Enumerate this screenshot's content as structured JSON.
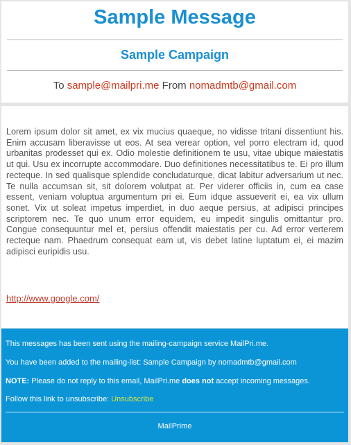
{
  "header": {
    "title": "Sample Message",
    "campaign": "Sample Campaign",
    "to_label": "To",
    "to_email": "sample@mailpri.me",
    "from_label": "From",
    "from_email": "nomadmtb@gmail.com"
  },
  "body": {
    "text": "Lorem ipsum dolor sit amet, ex vix mucius quaeque, no vidisse tritani dissentiunt his. Enim accusam liberavisse ut eos. At sea verear option, vel porro electram id, quod urbanitas prodesset qui ex. Odio molestie definitionem te usu, vitae ubique maiestatis ut qui. Usu ex incorrupte accommodare. Duo definitiones necessitatibus te. Ei pro illum recteque. In sed qualisque splendide concludaturque, dicat labitur adversarium ut nec. Te nulla accumsan sit, sit dolorem volutpat at. Per viderer officiis in, cum ea case essent, veniam voluptua argumentum pri ei. Eum idque assueverit ei, ea vix ullum sonet. Vix ut soleat impetus imperdiet, in duo aeque persius, at adipisci principes scriptorem nec. Te quo unum error equidem, eu impedit singulis omittantur pro. Congue consequuntur mel et, persius offendit maiestatis per cu. Ad error verterem recteque nam. Phaedrum consequat eam ut, vis debet latine luptatum ei, ei mazim adipisci euripidis usu.",
    "link": "http://www.google.com/"
  },
  "footer": {
    "line1": "This messages has been sent using the mailing-campaign service MailPri.me.",
    "line2": "You have been added to the mailing-list: Sample Campaign by nomadmtb@gmail.com",
    "note_label": "NOTE:",
    "note_text_a": " Please do not reply to this email, MailPri.me ",
    "note_emph": "does not",
    "note_text_b": " accept incoming messages.",
    "unsub_text": "Follow this link to unsubscribe: ",
    "unsub_link": "Unsubscribe",
    "brand": "MailPrime"
  },
  "colors": {
    "accent": "#1a8fd1",
    "email_red": "#cc3a1e",
    "footer_bg": "#0b95d7",
    "unsub_link": "#d9e640"
  }
}
